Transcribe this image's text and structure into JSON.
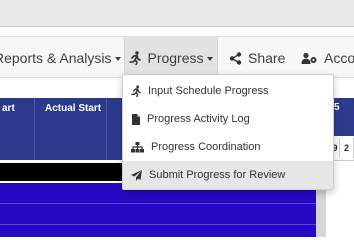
{
  "navbar": {
    "reports_label": "Reports & Analysis",
    "progress_label": "Progress",
    "share_label": "Share",
    "accounts_label": "Acco"
  },
  "grid": {
    "columns": [
      {
        "label": "art"
      },
      {
        "label": "Actual Start"
      }
    ],
    "right_header_number": "5",
    "right_days": [
      "19",
      "2"
    ]
  },
  "progress_menu": {
    "items": [
      {
        "label": "Input Schedule Progress",
        "icon": "running-person-icon"
      },
      {
        "label": "Progress Activity Log",
        "icon": "document-icon"
      },
      {
        "label": "Progress Coordination",
        "icon": "sitemap-icon"
      },
      {
        "label": "Submit Progress for Review",
        "icon": "paper-plane-icon",
        "highlighted": true
      }
    ]
  },
  "colors": {
    "nav_bg": "#f7f7f7",
    "grid_header": "#2c3a8c",
    "row_blue": "#2708c4",
    "row_black": "#000000",
    "menu_highlight": "#e6e6e6"
  }
}
